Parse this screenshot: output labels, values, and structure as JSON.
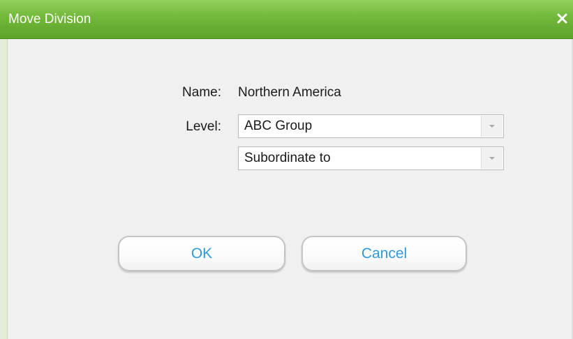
{
  "dialog": {
    "title": "Move Division",
    "close_glyph": "✕"
  },
  "form": {
    "name_label": "Name:",
    "name_value": "Northern America",
    "level_label": "Level:",
    "level_select_value": "ABC Group",
    "relation_select_value": "Subordinate to"
  },
  "buttons": {
    "ok_label": "OK",
    "cancel_label": "Cancel"
  },
  "colors": {
    "titlebar": "#72b83a",
    "button_text": "#2f9ad6",
    "background": "#f0f0f0"
  },
  "icons": {
    "close": "close-icon",
    "dropdown": "chevron-down-icon"
  }
}
